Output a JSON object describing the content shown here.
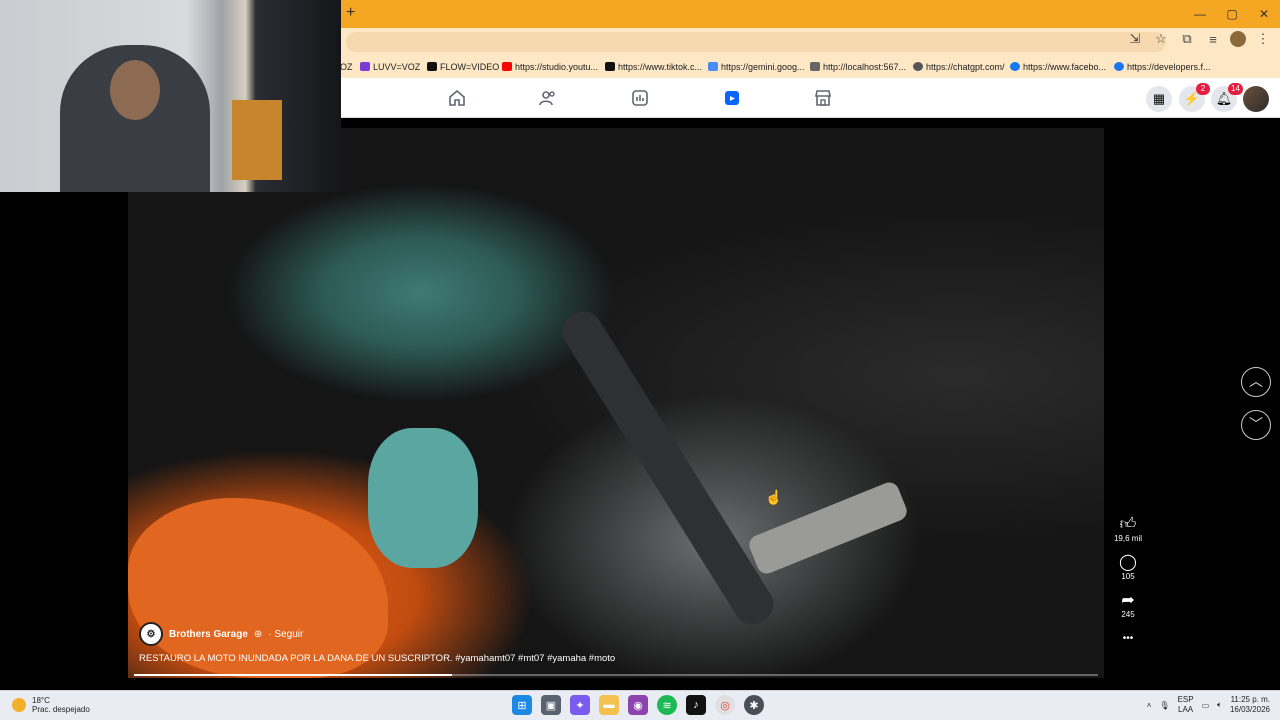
{
  "browser": {
    "new_tab_label": "+",
    "window_controls": [
      "—",
      "▢",
      "✕"
    ],
    "bookmarks": [
      {
        "label": "OZ",
        "color": "#5a5a5a"
      },
      {
        "label": "LUVV=VOZ",
        "color": "#7b3cd6"
      },
      {
        "label": "FLOW=VIDEO",
        "color": "#111111"
      },
      {
        "label": "https://studio.youtu...",
        "color": "#ff0000"
      },
      {
        "label": "https://www.tiktok.c...",
        "color": "#111111"
      },
      {
        "label": "https://gemini.goog...",
        "color": "#4b8bf5"
      },
      {
        "label": "http://localhost:567...",
        "color": "#666666"
      },
      {
        "label": "https://chatgpt.com/",
        "color": "#555555"
      },
      {
        "label": "https://www.facebo...",
        "color": "#1877f2"
      },
      {
        "label": "https://developers.f...",
        "color": "#1877f2"
      }
    ]
  },
  "facebook": {
    "nav_icons": [
      "home-icon",
      "friends-icon",
      "feeds-icon",
      "reels-icon",
      "marketplace-icon"
    ],
    "active_tab": "reels-icon",
    "messenger_badge": "2",
    "notifications_badge": "14",
    "accent": "#0866ff"
  },
  "reel": {
    "author": "Brothers Garage",
    "follow_label": "· Seguir",
    "caption": "RESTAURO LA MOTO INUNDADA POR LA DANA DE UN SUSCRIPTOR. #yamahamt07 #mt07 #yamaha #moto",
    "progress": 0.33,
    "likes": "19,6 mil",
    "comments": "105",
    "shares": "245",
    "more_label": "•••"
  },
  "taskbar": {
    "temperature": "18°C",
    "weather": "Prac. despejado",
    "lang_top": "ESP",
    "lang_bottom": "LAA",
    "time": "11:25 p. m.",
    "date": "16/03/2026"
  }
}
